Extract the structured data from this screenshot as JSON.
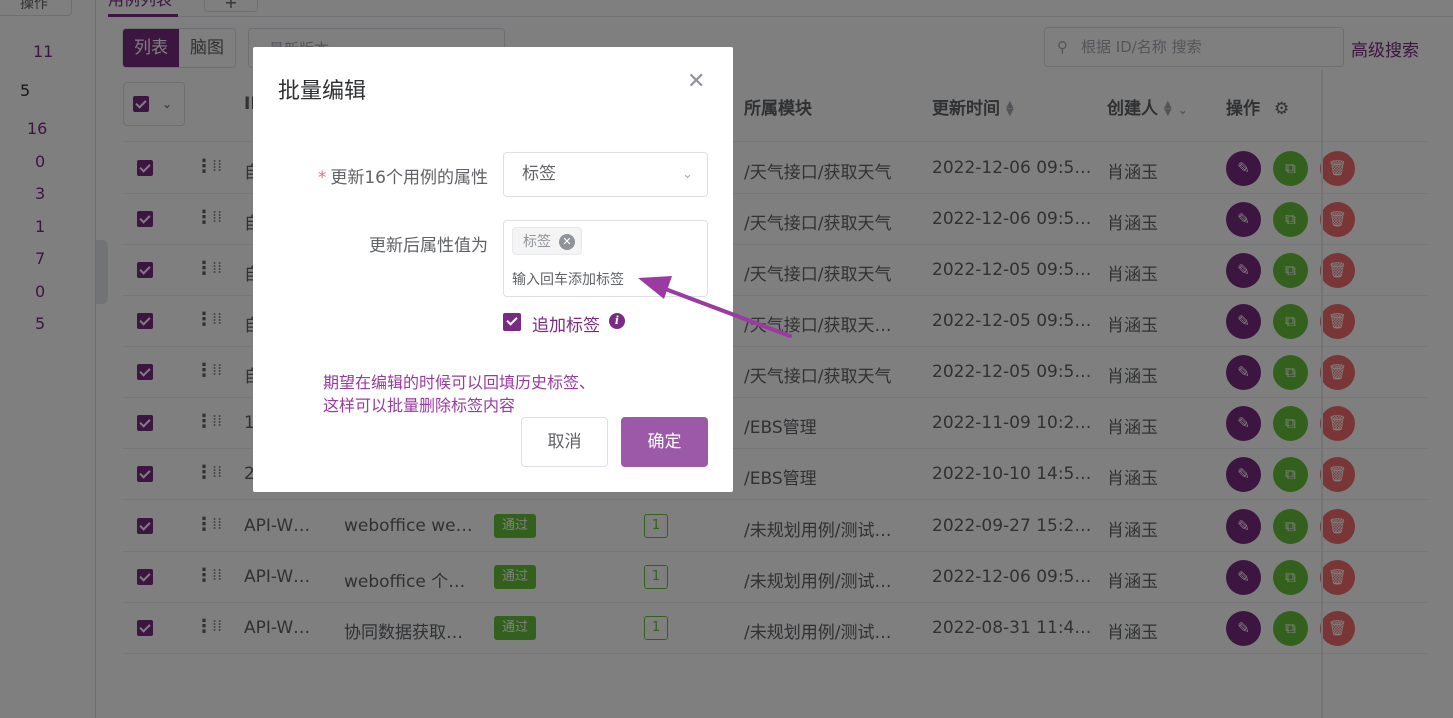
{
  "left_panel": {
    "top_button": "操作",
    "counts": [
      "11",
      "5",
      "16",
      "0",
      "3",
      "1",
      "7",
      "0",
      "5"
    ]
  },
  "tabs": {
    "active": "用例列表",
    "add": "+"
  },
  "toolbar": {
    "view_list": "列表",
    "view_mindmap": "脑图",
    "version_placeholder": "最新版本",
    "search_placeholder": "根据 ID/名称 搜索",
    "advanced_search": "高级搜索"
  },
  "table": {
    "headers": {
      "id": "ID",
      "module": "所属模块",
      "updated": "更新时间",
      "creator": "创建人",
      "actions": "操作"
    },
    "rows": [
      {
        "id": "自",
        "name": "",
        "status": "",
        "count": "",
        "module": "/天气接口/获取天气",
        "updated": "2022-12-06 09:5…",
        "creator": "肖涵玉"
      },
      {
        "id": "自",
        "name": "",
        "status": "",
        "count": "",
        "module": "/天气接口/获取天气",
        "updated": "2022-12-06 09:5…",
        "creator": "肖涵玉"
      },
      {
        "id": "自",
        "name": "",
        "status": "",
        "count": "",
        "module": "/天气接口/获取天气",
        "updated": "2022-12-05 09:5…",
        "creator": "肖涵玉"
      },
      {
        "id": "自",
        "name": "",
        "status": "",
        "count": "",
        "module": "/天气接口/获取天…",
        "updated": "2022-12-05 09:5…",
        "creator": "肖涵玉"
      },
      {
        "id": "自",
        "name": "",
        "status": "",
        "count": "",
        "module": "/天气接口/获取天气",
        "updated": "2022-12-05 09:5…",
        "creator": "肖涵玉"
      },
      {
        "id": "1",
        "name": "",
        "status": "",
        "count": "",
        "module": "/EBS管理",
        "updated": "2022-11-09 10:2…",
        "creator": "肖涵玉"
      },
      {
        "id": "2",
        "name": "",
        "status": "",
        "count": "",
        "module": "/EBS管理",
        "updated": "2022-10-10 14:5…",
        "creator": "肖涵玉"
      },
      {
        "id": "API-W…",
        "name": "weboffice we…",
        "status": "通过",
        "count": "1",
        "module": "/未规划用例/测试…",
        "updated": "2022-09-27 15:2…",
        "creator": "肖涵玉"
      },
      {
        "id": "API-W…",
        "name": "weboffice 个…",
        "status": "通过",
        "count": "1",
        "module": "/未规划用例/测试…",
        "updated": "2022-12-06 09:5…",
        "creator": "肖涵玉"
      },
      {
        "id": "API-W…",
        "name": "协同数据获取…",
        "status": "通过",
        "count": "1",
        "module": "/未规划用例/测试…",
        "updated": "2022-08-31 11:4…",
        "creator": "肖涵玉"
      }
    ]
  },
  "dialog": {
    "title": "批量编辑",
    "field1_label": "更新16个用例的属性",
    "field1_value": "标签",
    "field2_label": "更新后属性值为",
    "tag_chip": "标签",
    "tag_input_placeholder": "输入回车添加标签",
    "append_label": "追加标签",
    "note_line1": "期望在编辑的时候可以回填历史标签、",
    "note_line2": "这样可以批量删除标签内容",
    "cancel": "取消",
    "confirm": "确定"
  },
  "colors": {
    "brand": "#7b2a83",
    "success": "#67c23a",
    "danger": "#f56c6c",
    "annotation": "#9b3aa3"
  }
}
